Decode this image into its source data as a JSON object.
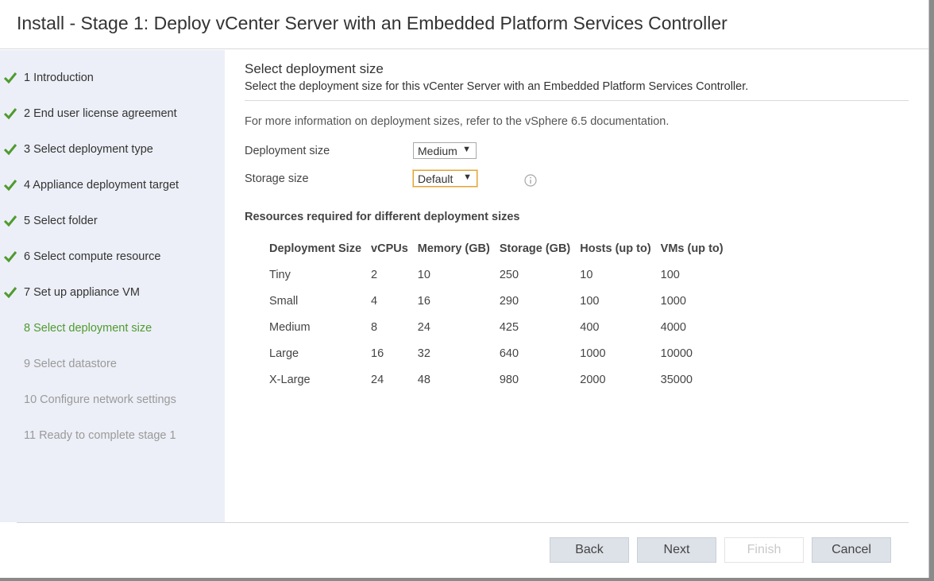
{
  "window": {
    "title": "Install - Stage 1: Deploy vCenter Server with an Embedded Platform Services Controller"
  },
  "sidebar": {
    "steps": [
      {
        "label": "1 Introduction",
        "state": "done"
      },
      {
        "label": "2 End user license agreement",
        "state": "done"
      },
      {
        "label": "3 Select deployment type",
        "state": "done"
      },
      {
        "label": "4 Appliance deployment target",
        "state": "done"
      },
      {
        "label": "5 Select folder",
        "state": "done"
      },
      {
        "label": "6 Select compute resource",
        "state": "done"
      },
      {
        "label": "7 Set up appliance VM",
        "state": "done"
      },
      {
        "label": "8 Select deployment size",
        "state": "current"
      },
      {
        "label": "9 Select datastore",
        "state": "todo"
      },
      {
        "label": "10 Configure network settings",
        "state": "todo"
      },
      {
        "label": "11 Ready to complete stage 1",
        "state": "todo"
      }
    ]
  },
  "main": {
    "heading": "Select deployment size",
    "subheading": "Select the deployment size for this vCenter Server with an Embedded Platform Services Controller.",
    "info_text": "For more information on deployment sizes, refer to the vSphere 6.5 documentation.",
    "deployment_size": {
      "label": "Deployment size",
      "value": "Medium"
    },
    "storage_size": {
      "label": "Storage size",
      "value": "Default"
    },
    "resources_title": "Resources required for different deployment sizes",
    "table": {
      "headers": [
        "Deployment Size",
        "vCPUs",
        "Memory (GB)",
        "Storage (GB)",
        "Hosts (up to)",
        "VMs (up to)"
      ],
      "rows": [
        [
          "Tiny",
          "2",
          "10",
          "250",
          "10",
          "100"
        ],
        [
          "Small",
          "4",
          "16",
          "290",
          "100",
          "1000"
        ],
        [
          "Medium",
          "8",
          "24",
          "425",
          "400",
          "4000"
        ],
        [
          "Large",
          "16",
          "32",
          "640",
          "1000",
          "10000"
        ],
        [
          "X-Large",
          "24",
          "48",
          "980",
          "2000",
          "35000"
        ]
      ]
    }
  },
  "footer": {
    "back": "Back",
    "next": "Next",
    "finish": "Finish",
    "cancel": "Cancel"
  },
  "colors": {
    "check_green": "#4f9b2f",
    "current_step": "#4f9b2f",
    "sidebar_bg": "#eceff7",
    "focus_border": "#e0a434"
  },
  "icons": {
    "step_done": "checkmark-icon",
    "info": "info-icon",
    "dropdown": "caret-down-icon"
  }
}
